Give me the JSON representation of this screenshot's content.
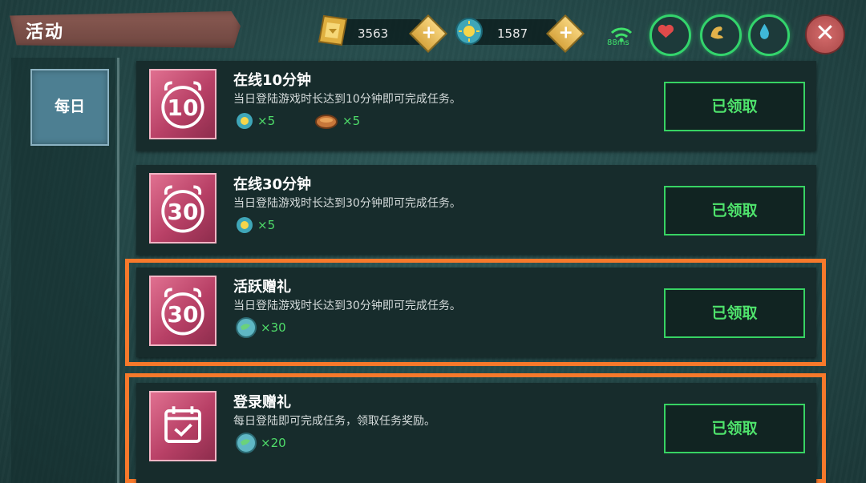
{
  "header": {
    "title": "活动",
    "gold": "3563",
    "sun_coins": "1587",
    "ping": "88ms"
  },
  "sidebar": {
    "tabs": [
      {
        "label": "每日"
      }
    ]
  },
  "tasks": [
    {
      "icon_text": "10",
      "title": "在线10分钟",
      "desc": "当日登陆游戏时长达到10分钟即可完成任务。",
      "rewards": [
        "×5",
        "×5"
      ],
      "button": "已领取"
    },
    {
      "icon_text": "30",
      "title": "在线30分钟",
      "desc": "当日登陆游戏时长达到30分钟即可完成任务。",
      "rewards": [
        "×5"
      ],
      "button": "已领取"
    },
    {
      "icon_text": "30",
      "title": "活跃赠礼",
      "desc": "当日登陆游戏时长达到30分钟即可完成任务。",
      "rewards": [
        "×30"
      ],
      "button": "已领取"
    },
    {
      "icon_text": "",
      "title": "登录赠礼",
      "desc": "每日登陆即可完成任务，领取任务奖励。",
      "rewards": [
        "×20"
      ],
      "button": "已领取"
    }
  ],
  "colors": {
    "accent_green": "#37d363",
    "highlight_orange": "#f7792b",
    "icon_pink": "#b84066"
  }
}
